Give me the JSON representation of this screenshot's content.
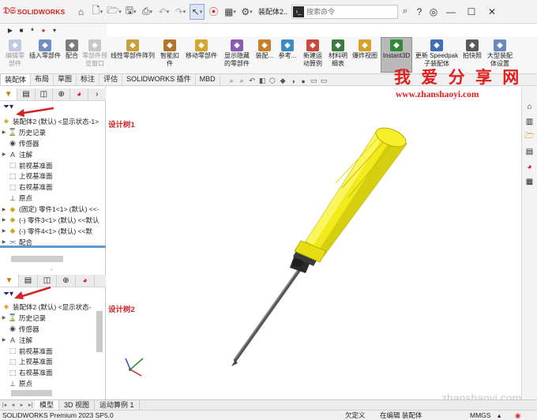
{
  "titlebar": {
    "logo_text": "SOLIDWORKS",
    "doc_title": "装配体2...",
    "search_placeholder": "搜索命令",
    "help_glyph": "?",
    "min_glyph": "—",
    "max_glyph": "☐",
    "close_glyph": "✕"
  },
  "ribbon": {
    "items": [
      {
        "label": "编辑零\n部件",
        "disabled": true,
        "color": "#8aa0c8"
      },
      {
        "label": "插入零部件",
        "disabled": false,
        "color": "#6c8fc7"
      },
      {
        "label": "配合",
        "disabled": false,
        "color": "#7c7c7c"
      },
      {
        "label": "零部件预\n览窗口",
        "disabled": true,
        "color": "#9a9a9a"
      },
      {
        "label": "线性零部件阵列",
        "disabled": false,
        "color": "#c7a13a"
      },
      {
        "label": "智能扣\n件",
        "disabled": false,
        "color": "#b5732b"
      },
      {
        "label": "移动零部件",
        "disabled": false,
        "color": "#d4a72c"
      },
      {
        "label": "显示隐藏\n的零部件",
        "disabled": false,
        "color": "#8a5bb5"
      },
      {
        "label": "装配...",
        "disabled": false,
        "color": "#c87f2a"
      },
      {
        "label": "参考...",
        "disabled": false,
        "color": "#3c8bc2"
      },
      {
        "label": "新建运\n动算例",
        "disabled": false,
        "color": "#c94a3a"
      },
      {
        "label": "材料明\n细表",
        "disabled": false,
        "color": "#3c7d3f"
      },
      {
        "label": "爆炸视图",
        "disabled": false,
        "color": "#d8a12a"
      },
      {
        "label": "Instant3D",
        "disabled": false,
        "color": "#2f8a3a",
        "active": true
      },
      {
        "label": "更新 Speedpak\n子装配体",
        "disabled": false,
        "color": "#3c6fb5"
      },
      {
        "label": "拍快照",
        "disabled": false,
        "color": "#5a5a5a"
      },
      {
        "label": "大型装配\n体设置",
        "disabled": false,
        "color": "#6a8ac0"
      }
    ]
  },
  "command_tabs": [
    "装配体",
    "布局",
    "草图",
    "标注",
    "评估",
    "SOLIDWORKS 插件",
    "MBD"
  ],
  "active_command_tab": "装配体",
  "tree1": {
    "root": "装配体2 (默认) <显示状态-1>",
    "items": [
      {
        "label": "历史记录",
        "icon": "history-icon",
        "glyph": "⌛",
        "arrow": true
      },
      {
        "label": "传感器",
        "icon": "sensor-icon",
        "glyph": "◉",
        "arrow": false
      },
      {
        "label": "注解",
        "icon": "annotation-icon",
        "glyph": "A",
        "arrow": true
      },
      {
        "label": "前视基准面",
        "icon": "plane-icon",
        "glyph": "⬚",
        "arrow": false
      },
      {
        "label": "上视基准面",
        "icon": "plane-icon",
        "glyph": "⬚",
        "arrow": false
      },
      {
        "label": "右视基准面",
        "icon": "plane-icon",
        "glyph": "⬚",
        "arrow": false
      },
      {
        "label": "原点",
        "icon": "origin-icon",
        "glyph": "⊥",
        "arrow": false
      },
      {
        "label": "(固定) 零件1<1> (默认) <<-",
        "icon": "part-icon",
        "glyph": "◆",
        "arrow": true
      },
      {
        "label": "(-) 零件3<1> (默认) <<默认",
        "icon": "part-icon",
        "glyph": "◆",
        "arrow": true
      },
      {
        "label": "(-) 零件4<1> (默认) <<默",
        "icon": "part-icon",
        "glyph": "◆",
        "arrow": true
      },
      {
        "label": "配合",
        "icon": "mate-icon",
        "glyph": "⫘",
        "arrow": true
      }
    ]
  },
  "tree2": {
    "root": "装配体2 (默认) <显示状态-",
    "items": [
      {
        "label": "历史记录",
        "icon": "history-icon",
        "glyph": "⌛",
        "arrow": true
      },
      {
        "label": "传感器",
        "icon": "sensor-icon",
        "glyph": "◉",
        "arrow": false
      },
      {
        "label": "注解",
        "icon": "annotation-icon",
        "glyph": "A",
        "arrow": true
      },
      {
        "label": "前视基准面",
        "icon": "plane-icon",
        "glyph": "⬚",
        "arrow": false
      },
      {
        "label": "上视基准面",
        "icon": "plane-icon",
        "glyph": "⬚",
        "arrow": false
      },
      {
        "label": "右视基准面",
        "icon": "plane-icon",
        "glyph": "⬚",
        "arrow": false
      },
      {
        "label": "原点",
        "icon": "origin-icon",
        "glyph": "⊥",
        "arrow": false
      }
    ]
  },
  "annotations": {
    "tree1_label": "设计树1",
    "tree2_label": "设计树2"
  },
  "watermark": {
    "cn": "我 爱 分 享 网",
    "url": "www.zhanshaoyi.com",
    "bottom": "zhanshaoyi.com"
  },
  "bottom_tabs": [
    "模型",
    "3D 视图",
    "运动算例 1"
  ],
  "active_bottom_tab": "模型",
  "status": {
    "version": "SOLIDWORKS Premium 2023 SP5.0",
    "undefined": "欠定义",
    "editing": "在编辑 装配体",
    "units": "MMGS"
  },
  "colors": {
    "handle": "#f2ea1a",
    "handle_dark": "#c6c00c",
    "collar": "#2b2b2b",
    "shaft": "#6a6a6a",
    "accent_red": "#d32424"
  }
}
